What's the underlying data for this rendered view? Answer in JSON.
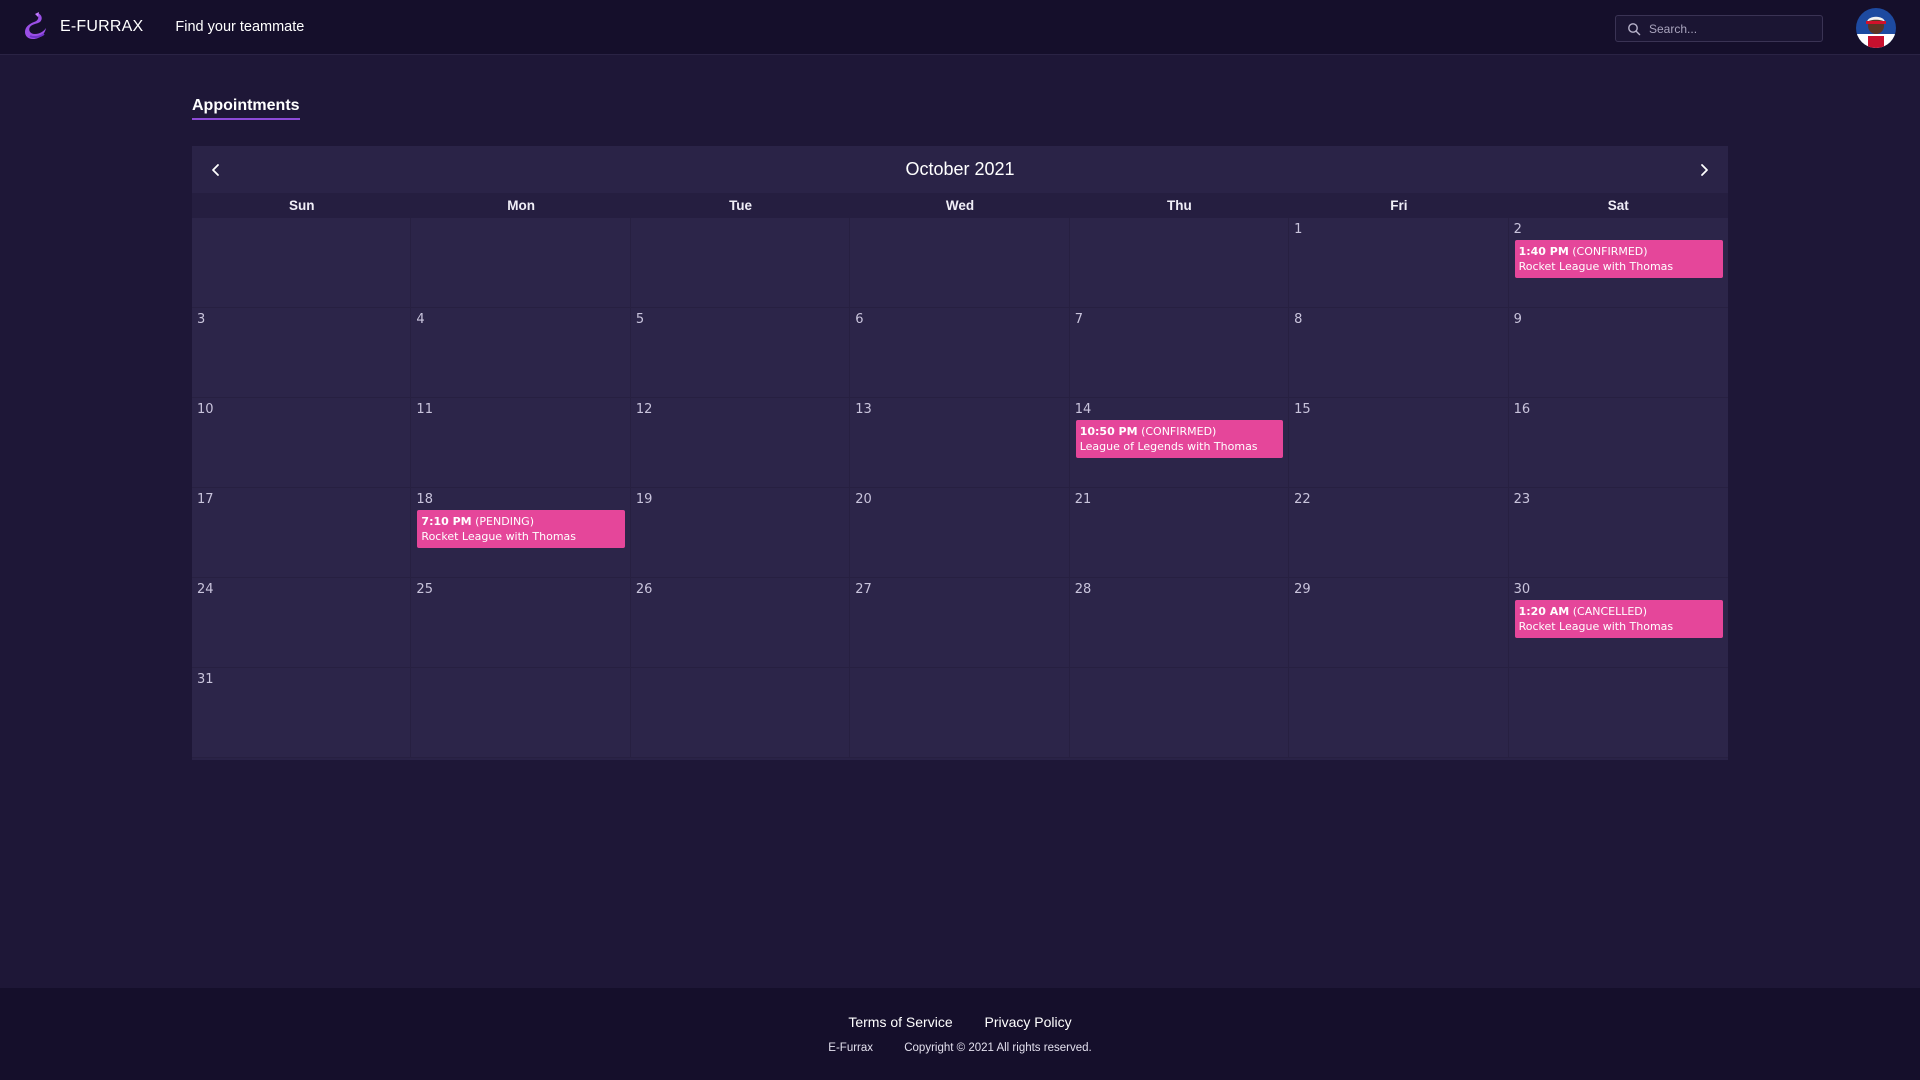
{
  "header": {
    "brand_name": "E-FURRAX",
    "nav_link": "Find your teammate",
    "search_placeholder": "Search...",
    "logo_icon": "dragon-logo-icon",
    "accent_color": "#8d4bd8"
  },
  "section_title": "Appointments",
  "calendar": {
    "month_label": "October 2021",
    "weekdays": [
      "Sun",
      "Mon",
      "Tue",
      "Wed",
      "Thu",
      "Fri",
      "Sat"
    ],
    "event_color": "#e5469a",
    "weeks": [
      [
        "",
        "",
        "",
        "",
        "",
        "1",
        "2"
      ],
      [
        "3",
        "4",
        "5",
        "6",
        "7",
        "8",
        "9"
      ],
      [
        "10",
        "11",
        "12",
        "13",
        "14",
        "15",
        "16"
      ],
      [
        "17",
        "18",
        "19",
        "20",
        "21",
        "22",
        "23"
      ],
      [
        "24",
        "25",
        "26",
        "27",
        "28",
        "29",
        "30"
      ],
      [
        "31",
        "",
        "",
        "",
        "",
        "",
        ""
      ]
    ],
    "events": [
      {
        "date": "2",
        "time": "1:40 PM",
        "status": "(CONFIRMED)",
        "title": "Rocket League with Thomas"
      },
      {
        "date": "14",
        "time": "10:50 PM",
        "status": "(CONFIRMED)",
        "title": "League of Legends with Thomas"
      },
      {
        "date": "18",
        "time": "7:10 PM",
        "status": "(PENDING)",
        "title": "Rocket League with Thomas"
      },
      {
        "date": "30",
        "time": "1:20 AM",
        "status": "(CANCELLED)",
        "title": "Rocket League with Thomas"
      }
    ]
  },
  "footer": {
    "terms": "Terms of Service",
    "privacy": "Privacy Policy",
    "brand": "E-Furrax",
    "copyright": "Copyright © 2021 All rights reserved."
  }
}
